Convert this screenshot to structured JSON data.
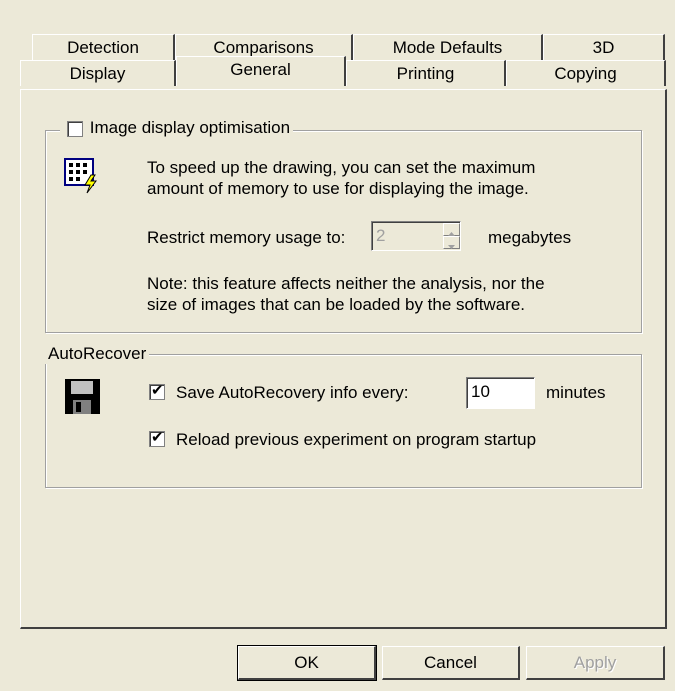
{
  "tabs_row1": [
    {
      "label": "Detection"
    },
    {
      "label": "Comparisons"
    },
    {
      "label": "Mode Defaults"
    },
    {
      "label": "3D"
    }
  ],
  "tabs_row2": [
    {
      "label": "Display"
    },
    {
      "label": "General"
    },
    {
      "label": "Printing"
    },
    {
      "label": "Copying"
    }
  ],
  "active_tab": "General",
  "image_group": {
    "checkbox_label": "Image display optimisation",
    "checked": false,
    "icon": "memory-grid-icon",
    "desc_line1": "To speed up the drawing, you can set the maximum",
    "desc_line2": "amount of memory to use for displaying the image.",
    "restrict_label": "Restrict memory usage to:",
    "restrict_value": "2",
    "restrict_unit": "megabytes",
    "note_line1": "Note: this feature affects neither the analysis, nor the",
    "note_line2": "size of images that can be loaded by the software."
  },
  "autorecover_group": {
    "title": "AutoRecover",
    "icon": "floppy-disk-icon",
    "save_label": "Save AutoRecovery info every:",
    "save_checked": true,
    "save_value": "10",
    "save_unit": "minutes",
    "reload_label": "Reload previous experiment on program startup",
    "reload_checked": true
  },
  "buttons": {
    "ok": "OK",
    "cancel": "Cancel",
    "apply": "Apply"
  }
}
